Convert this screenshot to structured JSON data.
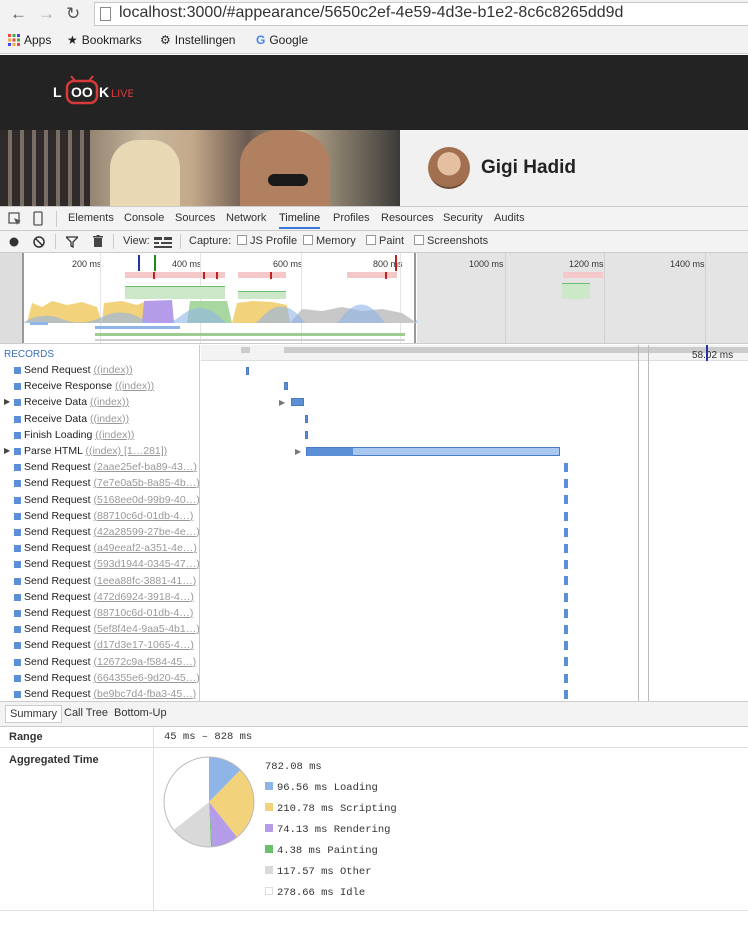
{
  "browser": {
    "url": "localhost:3000/#appearance/5650c2ef-4e59-4d3e-b1e2-8c6c8265dd9d",
    "bookmarks": [
      "Apps",
      "Bookmarks",
      "Instellingen",
      "Google"
    ]
  },
  "site": {
    "logo_text": "LOOKLIVE",
    "profile_name": "Gigi Hadid"
  },
  "devtools": {
    "tabs": [
      "Elements",
      "Console",
      "Sources",
      "Network",
      "Timeline",
      "Profiles",
      "Resources",
      "Security",
      "Audits"
    ],
    "active_tab": "Timeline",
    "toolbar": {
      "view_label": "View:",
      "capture_label": "Capture:",
      "js_profile": "JS Profile",
      "memory": "Memory",
      "paint": "Paint",
      "screenshots": "Screenshots"
    },
    "overview_ticks": [
      "200 ms",
      "400 ms",
      "600 ms",
      "800 ms",
      "1000 ms",
      "1200 ms",
      "1400 ms"
    ],
    "flame_marker": "58.02 ms",
    "records_header": "RECORDS",
    "records": [
      {
        "name": "Send Request",
        "detail": "(index)",
        "expandable": false
      },
      {
        "name": "Receive Response",
        "detail": "(index)",
        "expandable": false
      },
      {
        "name": "Receive Data",
        "detail": "(index)",
        "expandable": true
      },
      {
        "name": "Receive Data",
        "detail": "(index)",
        "expandable": false
      },
      {
        "name": "Finish Loading",
        "detail": "(index)",
        "expandable": false
      },
      {
        "name": "Parse HTML",
        "detail": "(index) [1…281]",
        "expandable": true
      },
      {
        "name": "Send Request",
        "detail": "2aae25ef-ba89-43…",
        "expandable": false
      },
      {
        "name": "Send Request",
        "detail": "7e7e0a5b-8a85-4b…",
        "expandable": false
      },
      {
        "name": "Send Request",
        "detail": "5168ee0d-99b9-40…",
        "expandable": false
      },
      {
        "name": "Send Request",
        "detail": "88710c6d-01db-4…",
        "expandable": false
      },
      {
        "name": "Send Request",
        "detail": "42a28599-27be-4e…",
        "expandable": false
      },
      {
        "name": "Send Request",
        "detail": "a49eeaf2-a351-4e…",
        "expandable": false
      },
      {
        "name": "Send Request",
        "detail": "593d1944-0345-47…",
        "expandable": false
      },
      {
        "name": "Send Request",
        "detail": "1eea88fc-3881-41…",
        "expandable": false
      },
      {
        "name": "Send Request",
        "detail": "472d6924-3918-4…",
        "expandable": false
      },
      {
        "name": "Send Request",
        "detail": "88710c6d-01db-4…",
        "expandable": false
      },
      {
        "name": "Send Request",
        "detail": "5ef8f4e4-9aa5-4b1…",
        "expandable": false
      },
      {
        "name": "Send Request",
        "detail": "d17d3e17-1065-4…",
        "expandable": false
      },
      {
        "name": "Send Request",
        "detail": "12672c9a-f584-45…",
        "expandable": false
      },
      {
        "name": "Send Request",
        "detail": "664355e6-9d20-45…",
        "expandable": false
      },
      {
        "name": "Send Request",
        "detail": "be9bc7d4-fba3-45…",
        "expandable": false
      }
    ],
    "summary_tabs": [
      "Summary",
      "Call Tree",
      "Bottom-Up"
    ],
    "summary": {
      "range_label": "Range",
      "range_value": "45 ms – 828 ms",
      "aggregated_label": "Aggregated Time",
      "total": "782.08 ms",
      "legend": [
        {
          "text": "96.56 ms Loading",
          "color": "#8fb4e8",
          "value": 96.56
        },
        {
          "text": "210.78 ms Scripting",
          "color": "#f2d27a",
          "value": 210.78
        },
        {
          "text": "74.13 ms Rendering",
          "color": "#b59ce8",
          "value": 74.13
        },
        {
          "text": "4.38 ms Painting",
          "color": "#6abf6a",
          "value": 4.38
        },
        {
          "text": "117.57 ms Other",
          "color": "#d9d9d9",
          "value": 117.57
        },
        {
          "text": "278.66 ms Idle",
          "color": "#ffffff",
          "value": 278.66
        }
      ]
    }
  }
}
